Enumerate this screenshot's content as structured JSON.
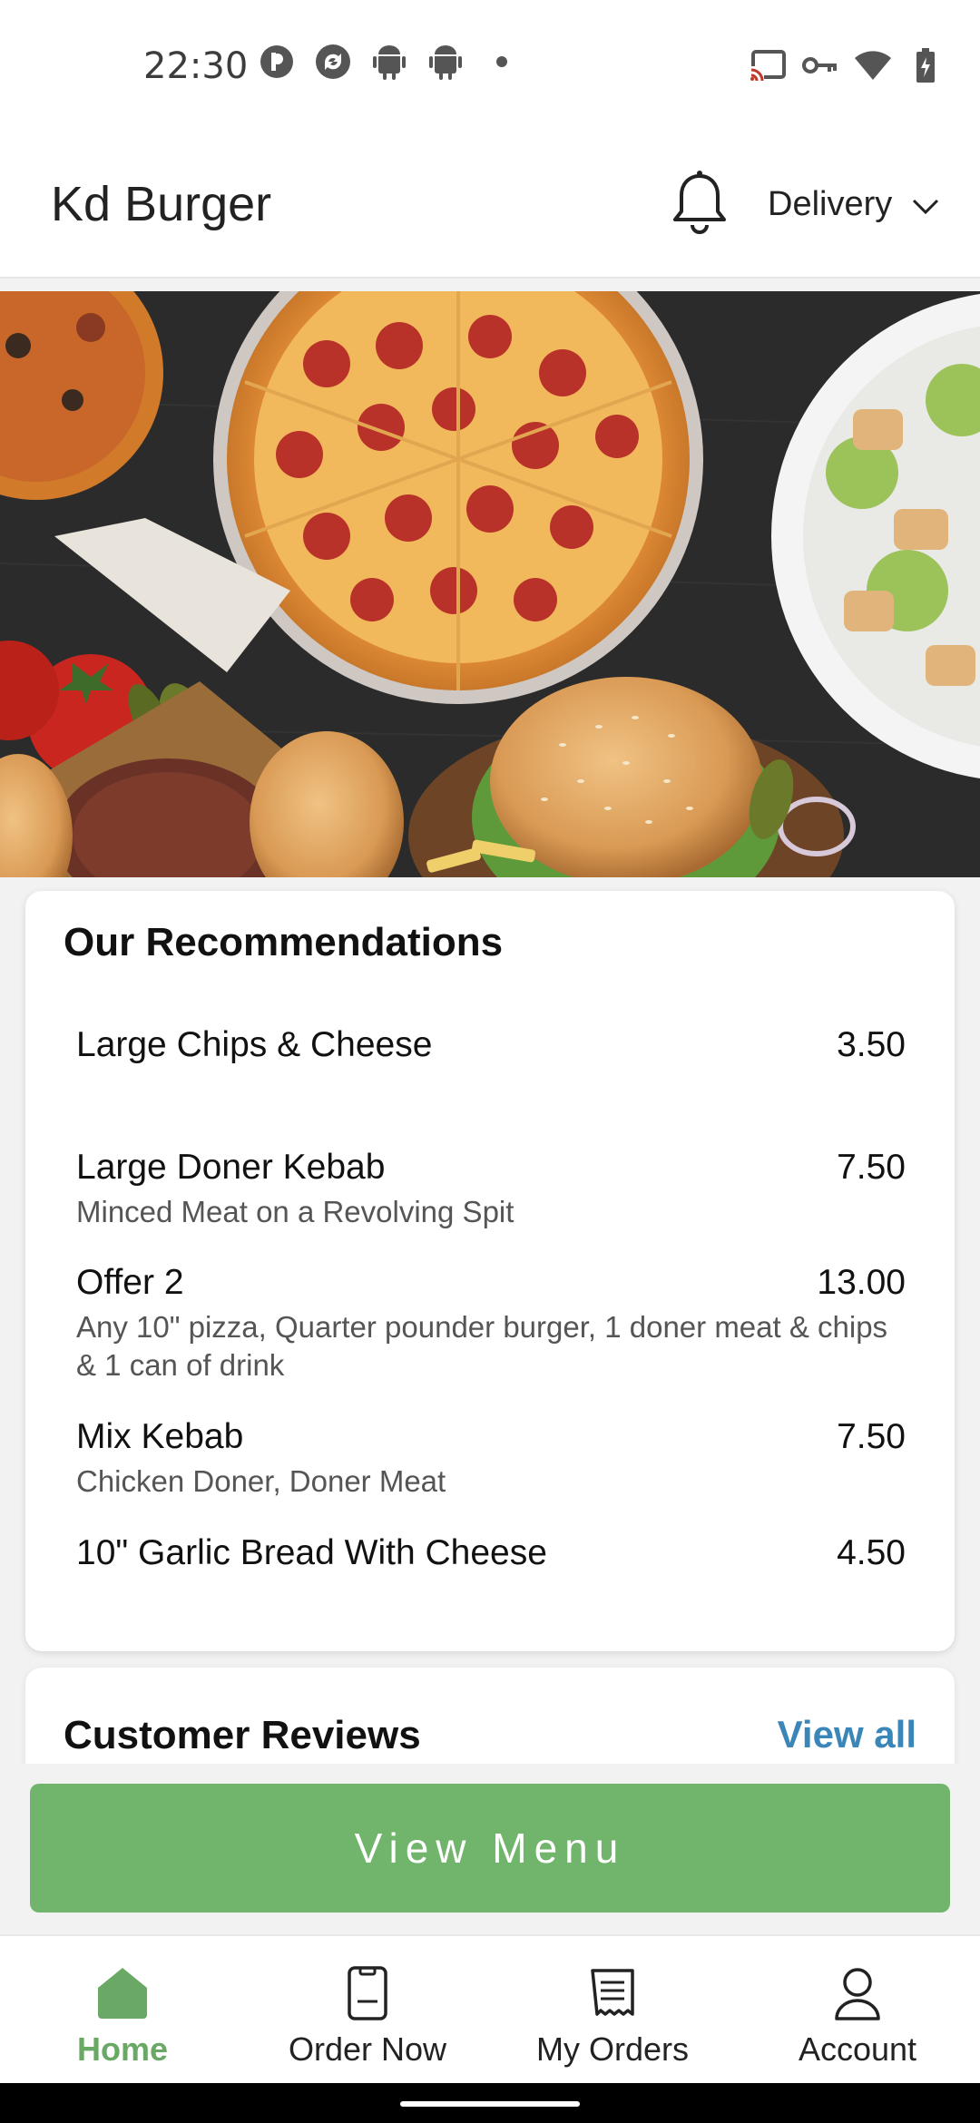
{
  "status_bar": {
    "time": "22:30",
    "left_icons": [
      "p-icon",
      "sync-icon",
      "android-icon",
      "android-icon",
      "dot-icon"
    ],
    "right_icons": [
      "cast-icon",
      "key-icon",
      "wifi-icon",
      "battery-charging-icon"
    ]
  },
  "app_bar": {
    "title": "Kd Burger",
    "notification_icon": "bell-icon",
    "mode_label": "Delivery",
    "mode_icon": "chevron-down-icon"
  },
  "hero": {
    "image": "food-banner-pizza-burger-salad"
  },
  "recommendations": {
    "title": "Our Recommendations",
    "items": [
      {
        "name": "Large Chips & Cheese",
        "price": "3.50",
        "description": ""
      },
      {
        "name": "Large Doner Kebab",
        "price": "7.50",
        "description": "Minced Meat on a Revolving Spit"
      },
      {
        "name": "Offer 2",
        "price": "13.00",
        "description": "Any 10\" pizza, Quarter pounder burger, 1 doner meat & chips & 1 can of drink"
      },
      {
        "name": "Mix Kebab",
        "price": "7.50",
        "description": "Chicken Doner, Doner Meat"
      },
      {
        "name": "10\" Garlic Bread With Cheese",
        "price": "4.50",
        "description": ""
      }
    ]
  },
  "reviews": {
    "title": "Customer Reviews",
    "view_all": "View all"
  },
  "view_menu_label": "View Menu",
  "bottom_nav": [
    {
      "label": "Home",
      "icon": "home-icon",
      "active": true
    },
    {
      "label": "Order Now",
      "icon": "order-icon",
      "active": false
    },
    {
      "label": "My Orders",
      "icon": "receipt-icon",
      "active": false
    },
    {
      "label": "Account",
      "icon": "user-icon",
      "active": false
    }
  ],
  "colors": {
    "accent_green": "#70b56b",
    "link_blue": "#3a86b8"
  }
}
